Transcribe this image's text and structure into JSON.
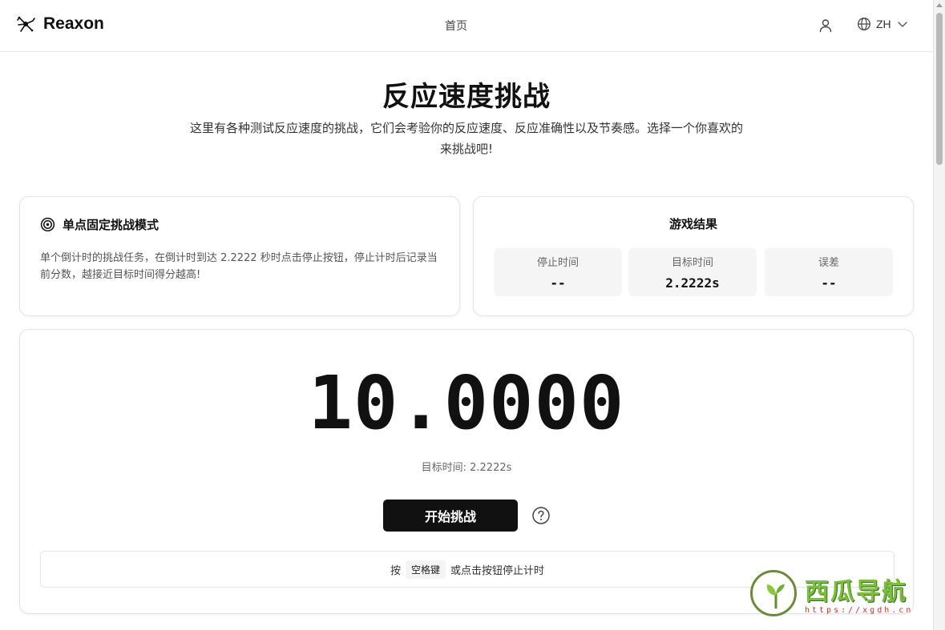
{
  "header": {
    "brand": "Reaxon",
    "nav_home": "首页",
    "lang": "ZH"
  },
  "hero": {
    "title": "反应速度挑战",
    "description": "这里有各种测试反应速度的挑战，它们会考验你的反应速度、反应准确性以及节奏感。选择一个你喜欢的来挑战吧!"
  },
  "mode": {
    "title": "单点固定挑战模式",
    "description": "单个倒计时的挑战任务，在倒计时到达 2.2222 秒时点击停止按钮，停止计时后记录当前分数，越接近目标时间得分越高!"
  },
  "results": {
    "title": "游戏结果",
    "stats": [
      {
        "label": "停止时间",
        "value": "--"
      },
      {
        "label": "目标时间",
        "value": "2.2222s"
      },
      {
        "label": "误差",
        "value": "--"
      }
    ]
  },
  "game": {
    "timer": "10.0000",
    "target_line": "目标时间: 2.2222s",
    "start_label": "开始挑战",
    "hint_prefix": "按",
    "hint_key": "空格键",
    "hint_suffix": "或点击按钮停止计时"
  },
  "watermark": {
    "text": "西瓜导航",
    "url": "https://xgdh.cn"
  },
  "colors": {
    "primary_button": "#111111",
    "stat_bg": "#f5f5f5",
    "watermark_green": "#7cbf3c"
  },
  "icons": {
    "brand": "neuron-logo-icon",
    "user": "user-icon",
    "lang": "globe-icon",
    "lang_dropdown": "chevron-down-icon",
    "mode": "target-icon",
    "help": "question-circle-icon"
  }
}
